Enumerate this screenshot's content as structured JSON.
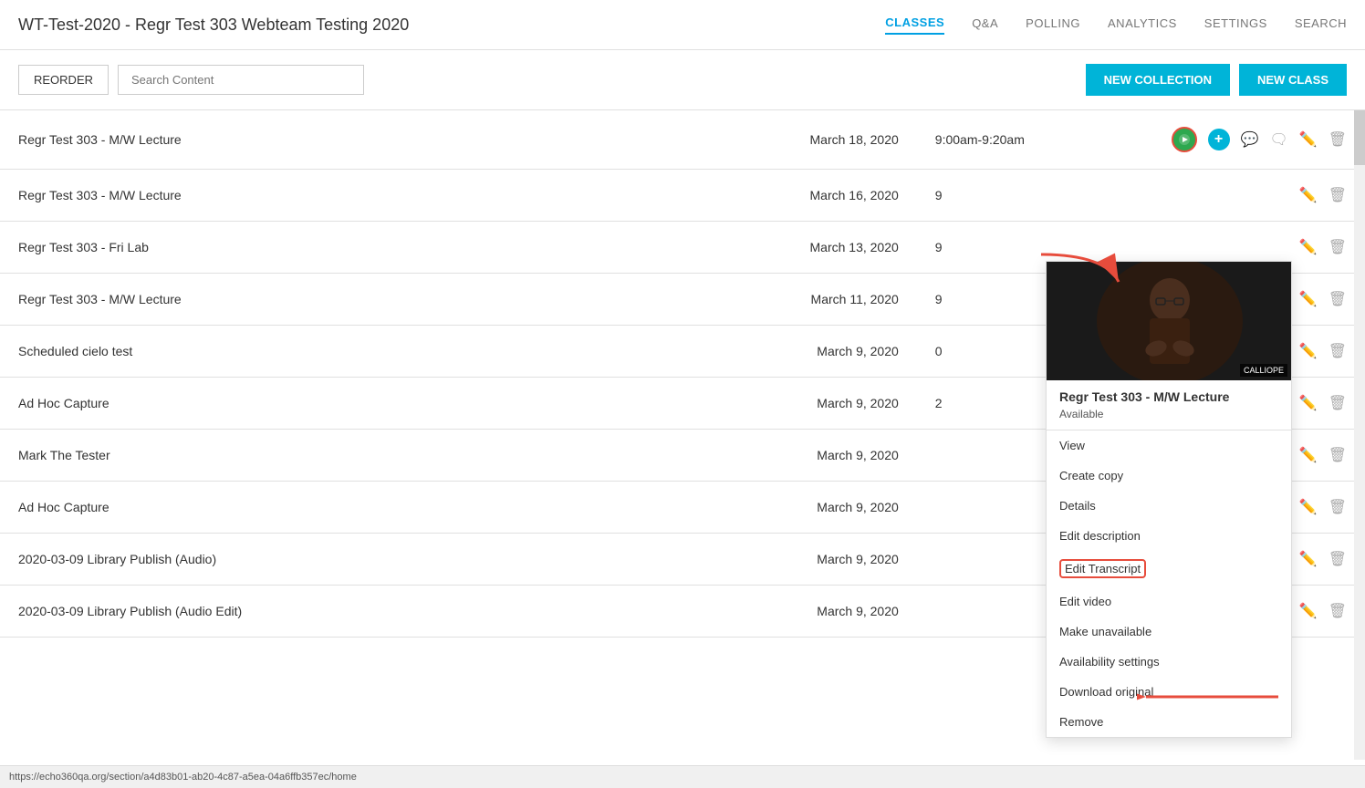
{
  "header": {
    "title": "WT-Test-2020 - Regr Test 303 Webteam Testing 2020",
    "nav": {
      "items": [
        {
          "label": "CLASSES",
          "active": true
        },
        {
          "label": "Q&A",
          "active": false
        },
        {
          "label": "POLLING",
          "active": false
        },
        {
          "label": "ANALYTICS",
          "active": false
        },
        {
          "label": "SETTINGS",
          "active": false
        },
        {
          "label": "SEARCH",
          "active": false
        }
      ]
    }
  },
  "toolbar": {
    "reorder_label": "REORDER",
    "search_placeholder": "Search Content",
    "new_collection_label": "NEW COLLECTION",
    "new_class_label": "NEW CLASS"
  },
  "classes": [
    {
      "name": "Regr Test 303 - M/W Lecture",
      "date": "March 18, 2020",
      "time": "9:00am-9:20am",
      "has_popup": true
    },
    {
      "name": "Regr Test 303 - M/W Lecture",
      "date": "March 16, 2020",
      "time": "9",
      "has_popup": false
    },
    {
      "name": "Regr Test 303 - Fri Lab",
      "date": "March 13, 2020",
      "time": "9",
      "has_popup": false
    },
    {
      "name": "Regr Test 303 - M/W Lecture",
      "date": "March 11, 2020",
      "time": "9",
      "has_popup": false
    },
    {
      "name": "Scheduled cielo test",
      "date": "March 9, 2020",
      "time": "0",
      "has_popup": false
    },
    {
      "name": "Ad Hoc Capture",
      "date": "March 9, 2020",
      "time": "2",
      "has_popup": false
    },
    {
      "name": "Mark The Tester",
      "date": "March 9, 2020",
      "time": "",
      "has_popup": false
    },
    {
      "name": "Ad Hoc Capture",
      "date": "March 9, 2020",
      "time": "",
      "has_popup": false
    },
    {
      "name": "2020-03-09 Library Publish (Audio)",
      "date": "March 9, 2020",
      "time": "",
      "has_popup": false
    },
    {
      "name": "2020-03-09 Library Publish (Audio Edit)",
      "date": "March 9, 2020",
      "time": "",
      "has_popup": false
    }
  ],
  "popup": {
    "title": "Regr Test 303 - M/W Lecture",
    "status": "Available",
    "thumbnail_label": "CALLIOPE",
    "menu_items": [
      {
        "label": "View",
        "highlighted": false
      },
      {
        "label": "Create copy",
        "highlighted": false
      },
      {
        "label": "Details",
        "highlighted": false
      },
      {
        "label": "Edit description",
        "highlighted": false
      },
      {
        "label": "Edit Transcript",
        "highlighted": true
      },
      {
        "label": "Edit video",
        "highlighted": false
      },
      {
        "label": "Make unavailable",
        "highlighted": false
      },
      {
        "label": "Availability settings",
        "highlighted": false
      },
      {
        "label": "Download original",
        "highlighted": false
      },
      {
        "label": "Remove",
        "highlighted": false
      }
    ]
  },
  "status_bar": {
    "url": "https://echo360qa.org/section/a4d83b01-ab20-4c87-a5ea-04a6ffb357ec/home"
  }
}
